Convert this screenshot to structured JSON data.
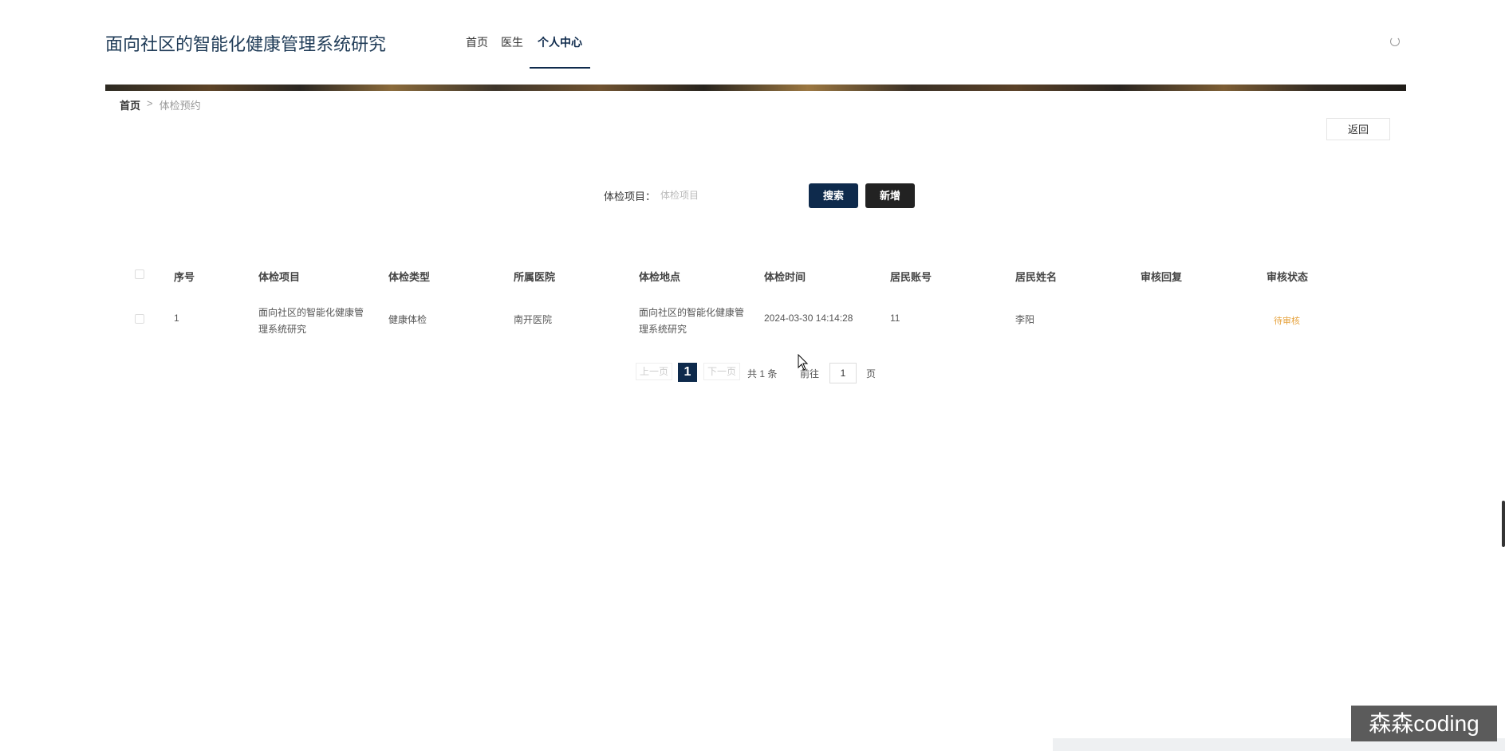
{
  "header": {
    "site_title": "面向社区的智能化健康管理系统研究",
    "nav": [
      "首页",
      "医生",
      "个人中心"
    ],
    "active_nav": "个人中心"
  },
  "breadcrumb": {
    "home": "首页",
    "separator": ">",
    "current": "体检预约"
  },
  "toolbar": {
    "back_label": "返回"
  },
  "search": {
    "label": "体检项目：",
    "placeholder": "体检项目",
    "search_label": "搜索",
    "add_label": "新增"
  },
  "table": {
    "headers": [
      "序号",
      "体检项目",
      "体检类型",
      "所属医院",
      "体检地点",
      "体检时间",
      "居民账号",
      "居民姓名",
      "审核回复",
      "审核状态"
    ],
    "rows": [
      {
        "index": "1",
        "item_line1": "面向社区的智能化健康管",
        "item_line2": "理系统研究",
        "type": "健康体检",
        "hospital": "南开医院",
        "location_line1": "面向社区的智能化健康管",
        "location_line2": "理系统研究",
        "time": "2024-03-30 14:14:28",
        "account": "11",
        "name": "李阳",
        "reply": "",
        "status": "待审核"
      }
    ]
  },
  "pagination": {
    "prev": "上一页",
    "current": "1",
    "next": "下一页",
    "total": "共 1 条",
    "goto": "前往",
    "page_input": "1",
    "page_unit": "页"
  },
  "watermark": "森森coding",
  "colors": {
    "primary": "#0e2a4c",
    "dark_button": "#222222",
    "status_pending": "#e6a23c",
    "title": "#1f3b57"
  }
}
